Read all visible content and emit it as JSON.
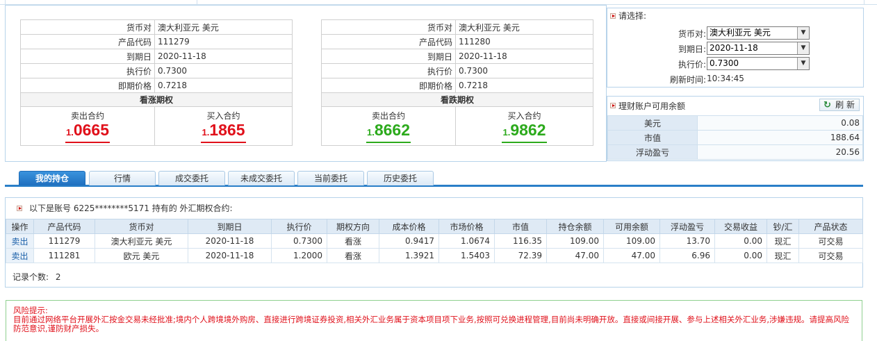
{
  "call_option": {
    "rows": [
      {
        "label": "货币对",
        "value": "澳大利亚元 美元"
      },
      {
        "label": "产品代码",
        "value": "111279"
      },
      {
        "label": "到期日",
        "value": "2020-11-18"
      },
      {
        "label": "执行价",
        "value": "0.7300"
      },
      {
        "label": "即期价格",
        "value": "0.7218"
      }
    ],
    "title": "看涨期权",
    "sell_label": "卖出合约",
    "sell_price_prefix": "1.",
    "sell_price_main": "0665",
    "buy_label": "买入合约",
    "buy_price_prefix": "1.",
    "buy_price_main": "1865"
  },
  "put_option": {
    "rows": [
      {
        "label": "货币对",
        "value": "澳大利亚元 美元"
      },
      {
        "label": "产品代码",
        "value": "111280"
      },
      {
        "label": "到期日",
        "value": "2020-11-18"
      },
      {
        "label": "执行价",
        "value": "0.7300"
      },
      {
        "label": "即期价格",
        "value": "0.7218"
      }
    ],
    "title": "看跌期权",
    "sell_label": "卖出合约",
    "sell_price_prefix": "1.",
    "sell_price_main": "8662",
    "buy_label": "买入合约",
    "buy_price_prefix": "1.",
    "buy_price_main": "9862"
  },
  "selector": {
    "title": "请选择:",
    "currency_label": "货币对:",
    "currency_value": "澳大利亚元 美元",
    "expiry_label": "到期日:",
    "expiry_value": "2020-11-18",
    "strike_label": "执行价:",
    "strike_value": "0.7300",
    "refresh_time_label": "刷新时间:",
    "refresh_time_value": "10:34:45"
  },
  "balance": {
    "title": "理财账户可用余额",
    "refresh_label": "刷 新",
    "rows": [
      {
        "label": "美元",
        "value": "0.08"
      },
      {
        "label": "市值",
        "value": "188.64"
      },
      {
        "label": "浮动盈亏",
        "value": "20.56"
      }
    ]
  },
  "tabs": [
    "我的持仓",
    "行情",
    "成交委托",
    "未成交委托",
    "当前委托",
    "历史委托"
  ],
  "holdings": {
    "caption": "以下是账号 6225********5171 持有的 外汇期权合约:",
    "columns": [
      "操作",
      "产品代码",
      "货币对",
      "到期日",
      "执行价",
      "期权方向",
      "成本价格",
      "市场价格",
      "市值",
      "持仓余额",
      "可用余额",
      "浮动盈亏",
      "交易收益",
      "钞/汇",
      "产品状态"
    ],
    "rows": [
      [
        "卖出",
        "111279",
        "澳大利亚元 美元",
        "2020-11-18",
        "0.7300",
        "看涨",
        "0.9417",
        "1.0674",
        "116.35",
        "109.00",
        "109.00",
        "13.70",
        "0.00",
        "现汇",
        "可交易"
      ],
      [
        "卖出",
        "111281",
        "欧元 美元",
        "2020-11-18",
        "1.2000",
        "看涨",
        "1.3921",
        "1.5403",
        "72.39",
        "47.00",
        "47.00",
        "6.96",
        "0.00",
        "现汇",
        "可交易"
      ]
    ],
    "count_label": "记录个数:",
    "count_value": "2"
  },
  "risk": {
    "title": "风险提示:",
    "text": "目前通过网络平台开展外汇按金交易未经批准;境内个人跨境境外购房、直接进行跨境证券投资,相关外汇业务属于资本项目项下业务,按照可兑换进程管理,目前尚未明确开放。直接或间接开展、参与上述相关外汇业务,涉嫌违规。请提高风险防范意识,谨防财产损失。"
  },
  "colors": {
    "sell_price": "#e0101a",
    "buy_price_put": "#2caa1c",
    "tab_active": "#2a7fc8"
  }
}
